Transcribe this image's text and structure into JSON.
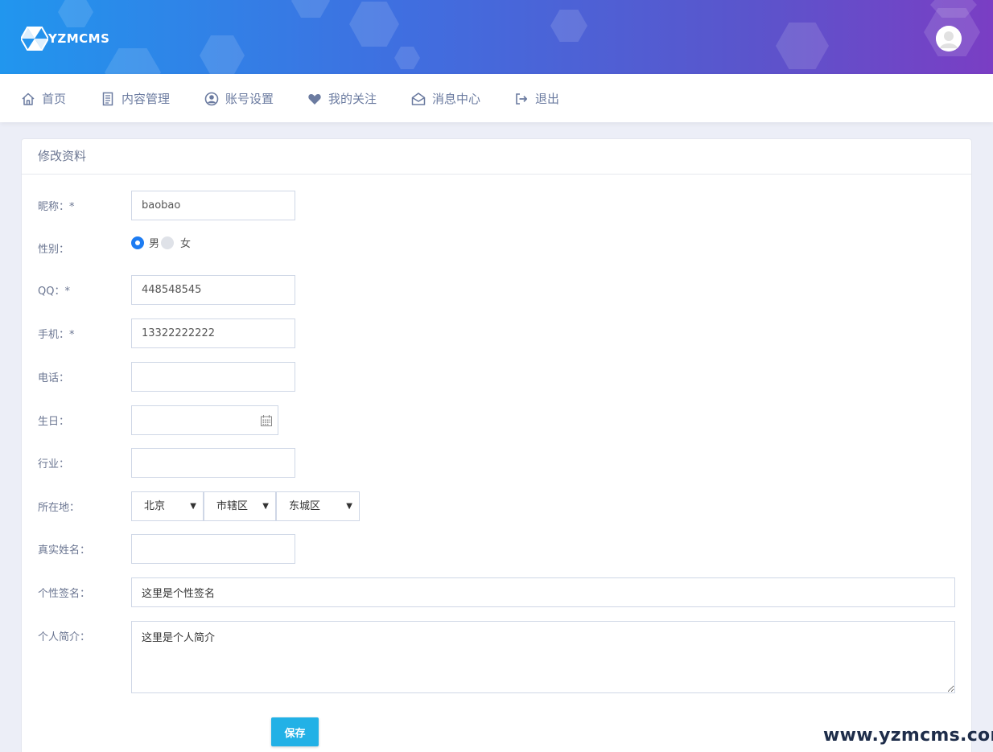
{
  "header": {
    "logo_text": "YZMCMS",
    "colors": {
      "gradient_start": "#2196ee",
      "gradient_end": "#7a3ec4"
    }
  },
  "nav": {
    "items": [
      {
        "label": "首页",
        "icon": "home-icon"
      },
      {
        "label": "内容管理",
        "icon": "document-icon"
      },
      {
        "label": "账号设置",
        "icon": "user-circle-icon"
      },
      {
        "label": "我的关注",
        "icon": "heart-icon"
      },
      {
        "label": "消息中心",
        "icon": "envelope-open-icon"
      },
      {
        "label": "退出",
        "icon": "sign-out-icon"
      }
    ]
  },
  "form": {
    "title": "修改资料",
    "nickname": {
      "label": "昵称：*",
      "value": "baobao"
    },
    "gender": {
      "label": "性别：",
      "options": [
        "男",
        "女"
      ],
      "selected": "男"
    },
    "qq": {
      "label": "QQ：*",
      "value": "448548545"
    },
    "mobile": {
      "label": "手机：*",
      "value": "13322222222"
    },
    "phone": {
      "label": "电话：",
      "value": ""
    },
    "birthday": {
      "label": "生日：",
      "value": "",
      "icon": "calendar-icon"
    },
    "industry": {
      "label": "行业：",
      "value": ""
    },
    "location": {
      "label": "所在地：",
      "province": "北京",
      "city": "市辖区",
      "district": "东城区"
    },
    "realname": {
      "label": "真实姓名：",
      "value": ""
    },
    "signature": {
      "label": "个性签名：",
      "value": "这里是个性签名"
    },
    "intro": {
      "label": "个人简介：",
      "value": "这里是个人简介"
    },
    "save_label": "保存"
  },
  "watermark": "www.yzmcms.com",
  "colors": {
    "accent": "#1d7cf2",
    "save_button": "#22b1e6",
    "nav_text": "#6b7ba0"
  }
}
